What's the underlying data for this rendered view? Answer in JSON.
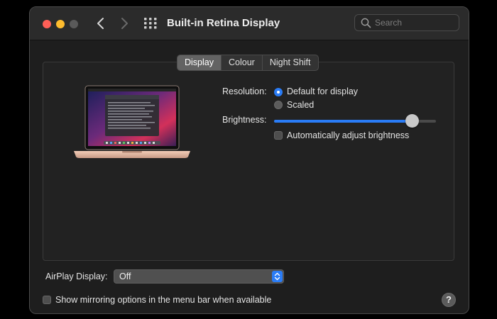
{
  "window": {
    "title": "Built-in Retina Display",
    "search_placeholder": "Search"
  },
  "tabs": [
    {
      "label": "Display",
      "active": true
    },
    {
      "label": "Colour",
      "active": false
    },
    {
      "label": "Night Shift",
      "active": false
    }
  ],
  "display": {
    "resolution_label": "Resolution:",
    "resolution_options": [
      {
        "label": "Default for display",
        "selected": true
      },
      {
        "label": "Scaled",
        "selected": false
      }
    ],
    "brightness_label": "Brightness:",
    "brightness_level": 0.85,
    "auto_brightness_label": "Automatically adjust brightness",
    "auto_brightness_checked": false
  },
  "airplay": {
    "label": "AirPlay Display:",
    "value": "Off"
  },
  "mirroring": {
    "label": "Show mirroring options in the menu bar when available",
    "checked": false
  },
  "help_symbol": "?",
  "icons": {
    "back": "chevron-left-icon",
    "forward": "chevron-right-icon",
    "show_all": "grid-icon",
    "search": "search-icon",
    "help": "help-icon",
    "display_preview": "laptop-icon"
  },
  "colors": {
    "accent": "#2a7cf6",
    "close": "#fe5f57",
    "minimize": "#febc2e",
    "zoom_disabled": "#5a5a5a",
    "window_bg": "#1e1e1e"
  }
}
